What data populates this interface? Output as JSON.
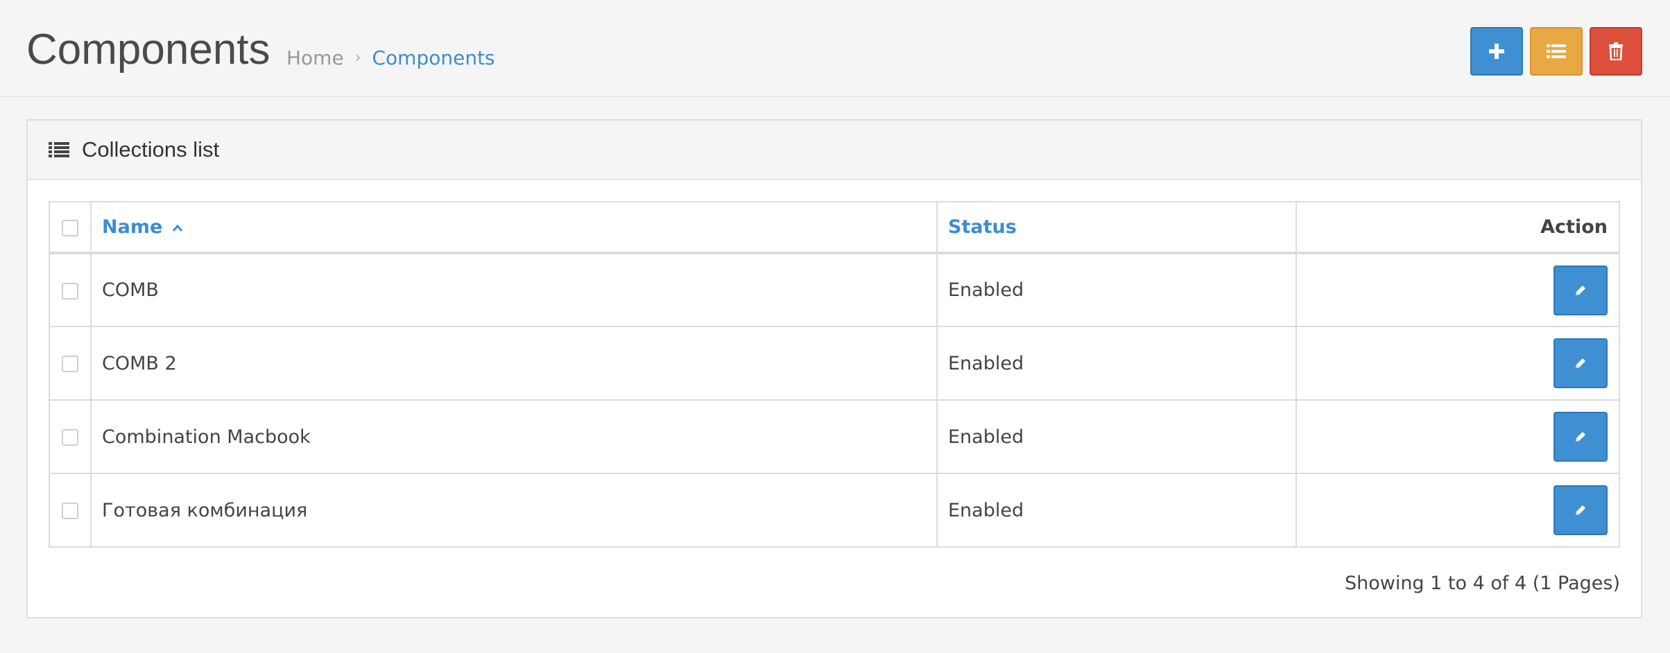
{
  "header": {
    "title": "Components",
    "breadcrumb": [
      {
        "label": "Home"
      },
      {
        "label": "Components"
      }
    ],
    "breadcrumb_separator": "›",
    "toolbar": [
      {
        "icon": "plus-icon",
        "color": "#3f90d2"
      },
      {
        "icon": "list-icon",
        "color": "#eaa845"
      },
      {
        "icon": "trash-icon",
        "color": "#dc503c"
      }
    ]
  },
  "panel": {
    "title": "Collections list",
    "icon": "list-icon"
  },
  "table": {
    "columns": {
      "name": "Name",
      "status": "Status",
      "action": "Action"
    },
    "sort": {
      "column": "name",
      "direction": "asc"
    },
    "rows": [
      {
        "name": "COMB",
        "status": "Enabled"
      },
      {
        "name": "COMB 2",
        "status": "Enabled"
      },
      {
        "name": "Combination Macbook",
        "status": "Enabled"
      },
      {
        "name": "Готовая комбинация",
        "status": "Enabled"
      }
    ]
  },
  "pagination": {
    "summary": "Showing 1 to 4 of 4 (1 Pages)"
  },
  "colors": {
    "primary": "#3f90d2",
    "warning": "#eaa845",
    "danger": "#dc503c",
    "link": "#3c8dce"
  }
}
